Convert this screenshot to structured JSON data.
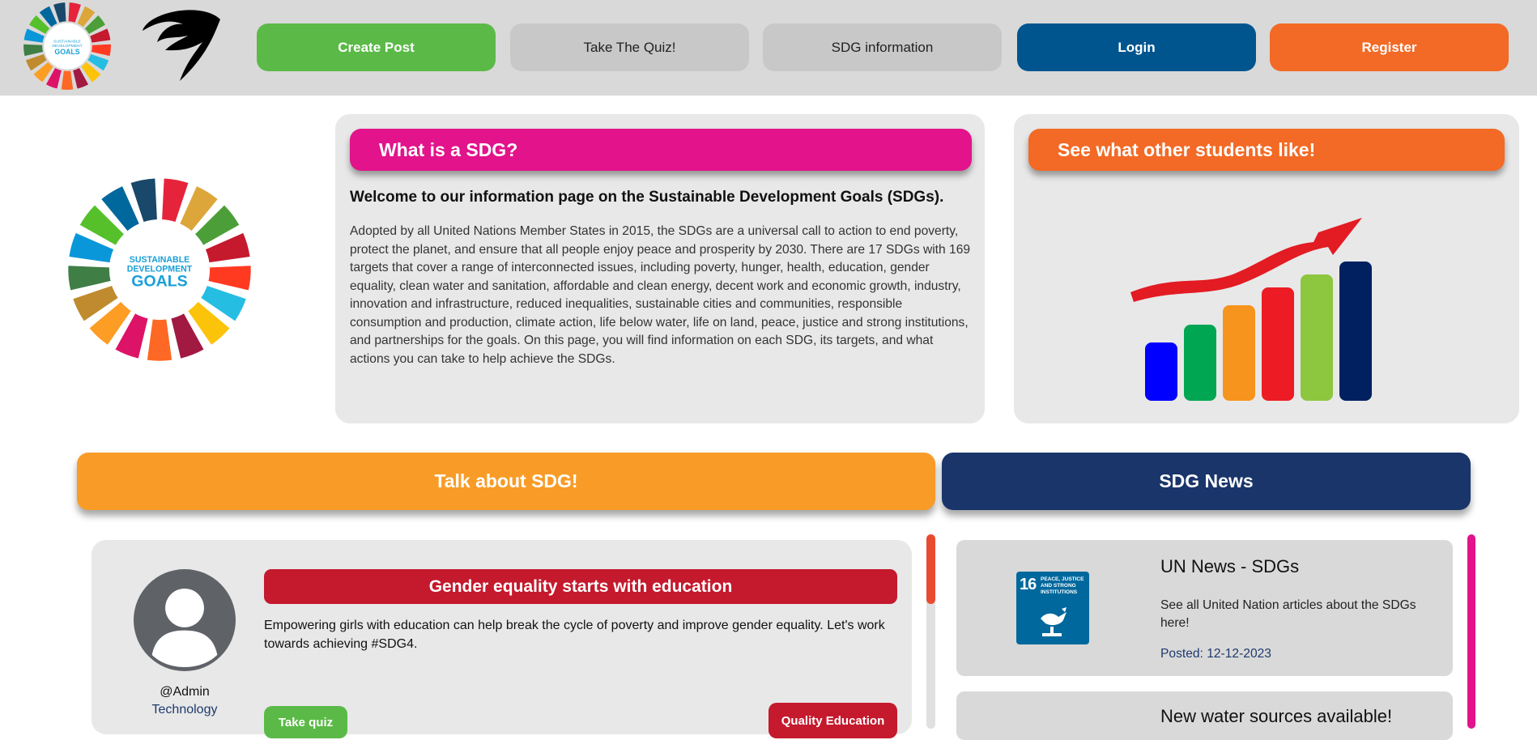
{
  "header": {
    "create_post": "Create Post",
    "take_quiz": "Take The Quiz!",
    "sdg_information": "SDG information",
    "login": "Login",
    "register": "Register"
  },
  "logo": {
    "wheel_line1": "SUSTAINABLE",
    "wheel_line2": "DEVELOPMENT",
    "wheel_line3": "GOALS"
  },
  "info": {
    "title": "What is a SDG?",
    "heading": "Welcome to our information page on the Sustainable Development Goals (SDGs).",
    "body": "Adopted by all United Nations Member States in 2015, the SDGs are a universal call to action to end poverty, protect the planet, and ensure that all people enjoy peace and prosperity by 2030. There are 17 SDGs with 169 targets that cover a range of interconnected issues, including poverty, hunger, health, education, gender equality, clean water and sanitation, affordable and clean energy, decent work and economic growth, industry, innovation and infrastructure, reduced inequalities, sustainable cities and communities, responsible consumption and production, climate action, life below water, life on land, peace, justice and strong institutions, and partnerships for the goals. On this page, you will find information on each SDG, its targets, and what actions you can take to help achieve the SDGs."
  },
  "students": {
    "title": "See what other students like!",
    "bar_colors": [
      "#0000ff",
      "#00a651",
      "#f7941d",
      "#ed1c24",
      "#8dc63f",
      "#002060"
    ],
    "arrow_color": "#e31b23"
  },
  "sections": {
    "talk": "Talk about SDG!",
    "news": "SDG News"
  },
  "post": {
    "user": "@Admin",
    "category_text": "Technology",
    "title": "Gender equality starts with education",
    "body": "Empowering girls with education can help break the cycle of poverty and improve gender equality. Let's work towards achieving #SDG4.",
    "quiz_tag": "Take quiz",
    "category_tag": "Quality Education"
  },
  "news": [
    {
      "thumb_number": "16",
      "thumb_text": "PEACE, JUSTICE AND STRONG INSTITUTIONS",
      "title": "UN News - SDGs",
      "description": "See all United Nation articles about the SDGs here!",
      "date": "Posted: 12-12-2023"
    },
    {
      "title": "New water sources available!"
    }
  ],
  "colors": {
    "sdg_wheel": [
      "#e5243b",
      "#dda63a",
      "#4c9f38",
      "#c5192d",
      "#ff3a21",
      "#26bde2",
      "#fcc30b",
      "#a21942",
      "#fd6925",
      "#dd1367",
      "#fd9d24",
      "#bf8b2e",
      "#3f7e44",
      "#0a97d9",
      "#56c02b",
      "#00689d",
      "#19486a"
    ]
  }
}
